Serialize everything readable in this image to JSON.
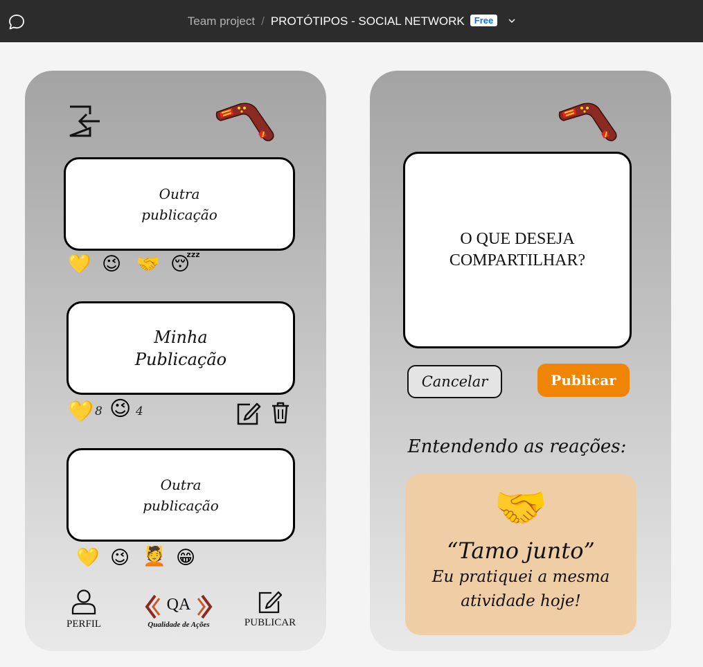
{
  "topbar": {
    "team": "Team project",
    "separator": "/",
    "project": "PROTÓTIPOS - SOCIAL NETWORK",
    "badge": "Free"
  },
  "feed": {
    "posts": [
      {
        "title_line1": "Outra",
        "title_line2": "publicação",
        "reactions": [
          "💛",
          "😉",
          "🤝",
          "😴"
        ]
      },
      {
        "title_line1": "Minha",
        "title_line2": "Publicação",
        "reactions": [
          "💛",
          "😉"
        ],
        "counts": [
          "8",
          "4"
        ]
      },
      {
        "title_line1": "Outra",
        "title_line2": "publicação",
        "reactions": [
          "💛",
          "😉",
          "💆",
          "😁"
        ]
      }
    ]
  },
  "nav": {
    "perfil": "PERFIL",
    "publicar": "PUBLICAR",
    "logo_text": "QA",
    "logo_sub": "Qualidade de Ações"
  },
  "compose": {
    "placeholder_line1": "O QUE DESEJA",
    "placeholder_line2": "COMPARTILHAR?",
    "cancel": "Cancelar",
    "publish": "Publicar"
  },
  "legend": {
    "heading": "Entendendo as reações:",
    "emoji": "🤝",
    "quote": "“Tamo junto”",
    "desc_line1": "Eu pratiquei a mesma",
    "desc_line2": "atividade hoje!"
  },
  "colors": {
    "accent": "#f08405",
    "legend_bg": "#efcea6",
    "topbar": "#2c2c2c"
  }
}
